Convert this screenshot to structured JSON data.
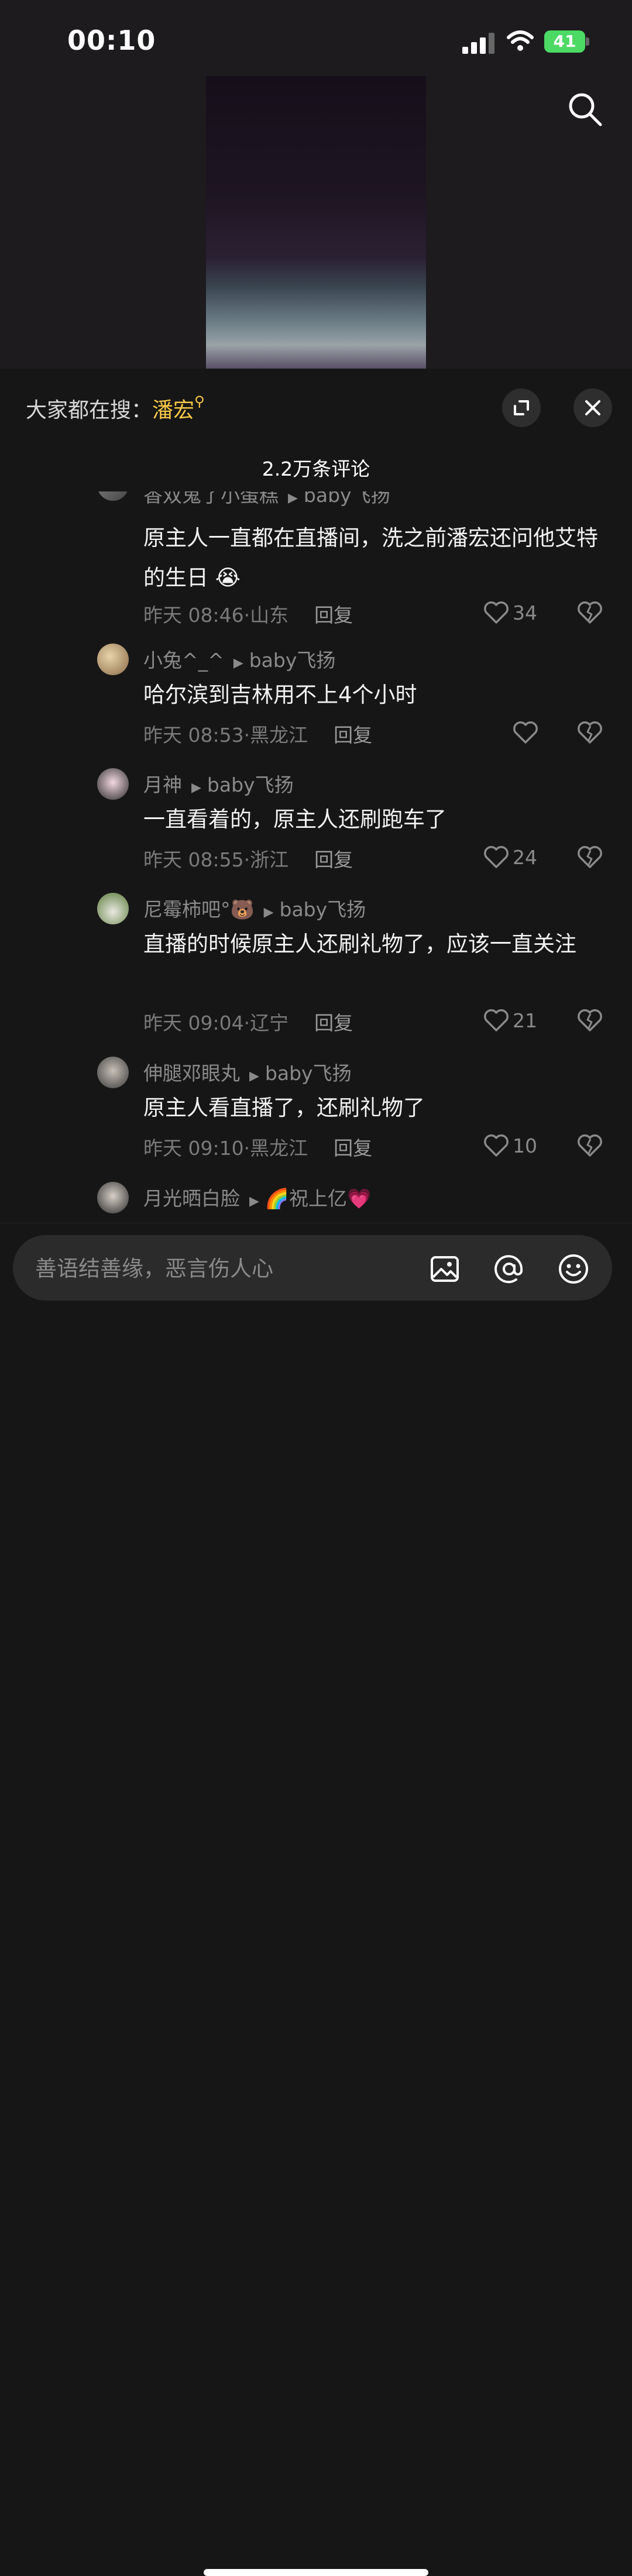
{
  "status": {
    "time": "00:10",
    "battery": "41"
  },
  "trending": {
    "prefix": "大家都在搜：",
    "keyword": "潘宏"
  },
  "comment_count": "2.2万条评论",
  "comments": [
    {
      "user": "香双鬼了小蛋糕",
      "reply_to": "baby飞扬",
      "text": "原主人一直都在直播间，洗之前潘宏还问他艾特的生日 😭",
      "time": "昨天 08:46",
      "region": "山东",
      "reply_label": "回复",
      "likes": "34"
    },
    {
      "user": "小兔^_^",
      "reply_to": "baby飞扬",
      "text": "哈尔滨到吉林用不上4个小时",
      "time": "昨天 08:53",
      "region": "黑龙江",
      "reply_label": "回复",
      "likes": ""
    },
    {
      "user": "月神",
      "reply_to": "baby飞扬",
      "text": "一直看着的，原主人还刷跑车了",
      "time": "昨天 08:55",
      "region": "浙江",
      "reply_label": "回复",
      "likes": "24"
    },
    {
      "user": "尼霉柿吧°🐻",
      "reply_to": "baby飞扬",
      "text": "直播的时候原主人还刷礼物了，应该一直关注",
      "time": "昨天 09:04",
      "region": "辽宁",
      "reply_label": "回复",
      "likes": "21"
    },
    {
      "user": "伸腿邓眼丸",
      "reply_to": "baby飞扬",
      "text": "原主人看直播了，还刷礼物了",
      "time": "昨天 09:10",
      "region": "黑龙江",
      "reply_label": "回复",
      "likes": "10"
    },
    {
      "user": "月光晒白脸",
      "reply_to": "🌈祝上亿💗",
      "text": "",
      "time": "",
      "region": "",
      "reply_label": "",
      "likes": ""
    }
  ],
  "composer": {
    "placeholder": "善语结善缘，恶言伤人心"
  },
  "icons": {
    "search": "search-icon",
    "expand": "expand-icon",
    "close": "close-icon",
    "like": "heart-icon",
    "dislike": "broken-heart-icon",
    "image": "image-icon",
    "mention": "at-icon",
    "emoji": "emoji-icon"
  },
  "colors": {
    "accent": "#f7c948",
    "battery": "#4cd964",
    "background": "#161616"
  }
}
